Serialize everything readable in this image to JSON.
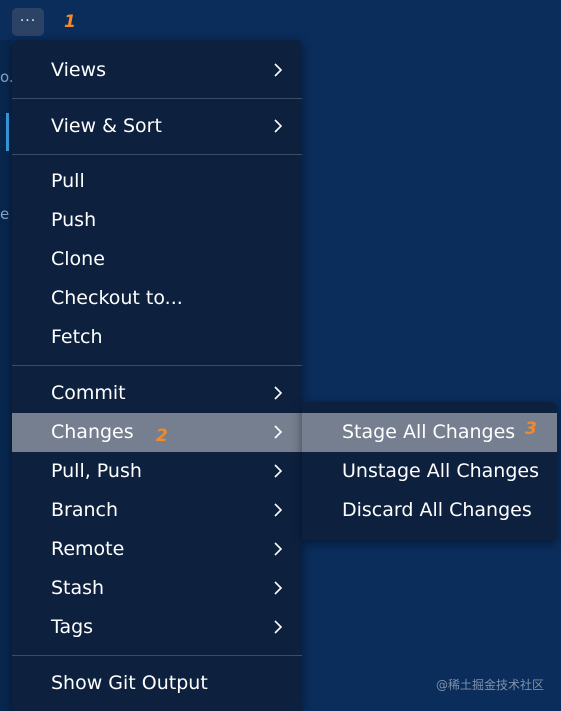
{
  "annotations": {
    "a1": "1",
    "a2": "2",
    "a3": "3"
  },
  "left_panel": {
    "text1": "o.",
    "text2": "e"
  },
  "more_button": {
    "label": "···",
    "icon": "more-icon"
  },
  "menu": {
    "views": "Views",
    "view_sort": "View & Sort",
    "pull": "Pull",
    "push": "Push",
    "clone": "Clone",
    "checkout": "Checkout to...",
    "fetch": "Fetch",
    "commit": "Commit",
    "changes": "Changes",
    "pull_push": "Pull, Push",
    "branch": "Branch",
    "remote": "Remote",
    "stash": "Stash",
    "tags": "Tags",
    "show_git_output": "Show Git Output"
  },
  "submenu": {
    "stage_all": "Stage All Changes",
    "unstage_all": "Unstage All Changes",
    "discard_all": "Discard All Changes"
  },
  "watermark": "@稀土掘金技术社区",
  "colors": {
    "background": "#0a2d5c",
    "menu": "#0d213f",
    "highlight": "#757f8f",
    "annotation": "#f08a2c"
  }
}
